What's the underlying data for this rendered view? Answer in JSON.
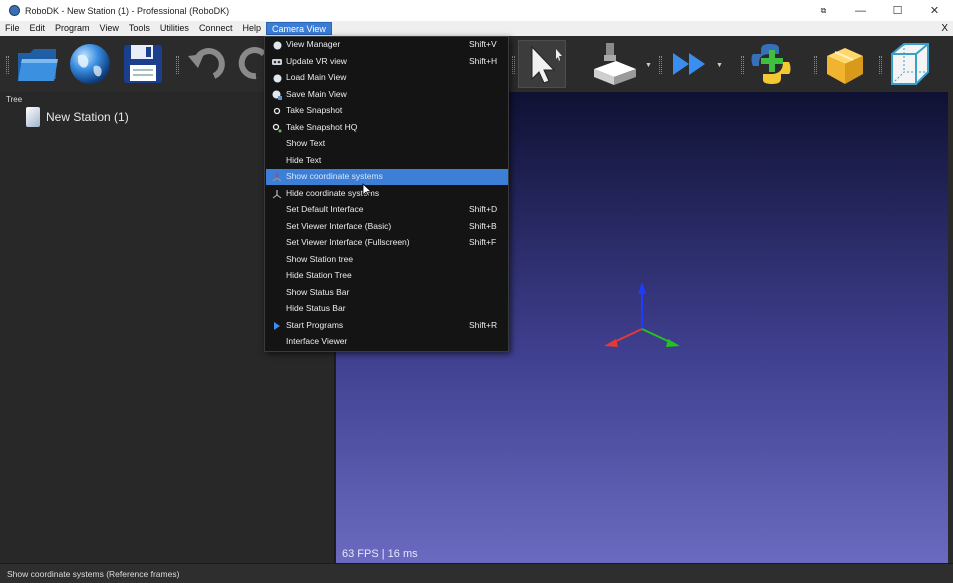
{
  "window": {
    "title": "RoboDK - New Station (1) - Professional (RoboDK)",
    "buttons": {
      "extra": "⧉",
      "minimize": "—",
      "maximize": "☐",
      "close": "✕"
    }
  },
  "menubar": {
    "items": [
      "File",
      "Edit",
      "Program",
      "View",
      "Tools",
      "Utilities",
      "Connect",
      "Help",
      "Camera View"
    ],
    "active": "Camera View",
    "close": "X"
  },
  "toolbar": {
    "tools": [
      {
        "name": "open-folder-icon"
      },
      {
        "name": "globe-icon"
      },
      {
        "name": "save-icon"
      },
      {
        "name": "undo-icon"
      },
      {
        "name": "redo-icon"
      },
      {
        "name": "select-cursor-icon",
        "pressed": true
      },
      {
        "name": "reference-frame-tool-icon"
      },
      {
        "name": "fast-forward-icon"
      },
      {
        "name": "python-add-icon"
      },
      {
        "name": "package-icon"
      },
      {
        "name": "view-cube-icon"
      }
    ]
  },
  "tree": {
    "label": "Tree",
    "nodes": [
      {
        "label": "New Station (1)",
        "icon": "station-icon"
      }
    ]
  },
  "viewport": {
    "fps_text": "63 FPS | 16 ms",
    "axes_colors": {
      "x": "#e53935",
      "y": "#21c321",
      "z": "#1c3cff"
    }
  },
  "menu": {
    "items": [
      {
        "label": "View Manager",
        "shortcut": "Shift+V",
        "icon": "globe-small-icon"
      },
      {
        "label": "Update VR view",
        "shortcut": "Shift+H",
        "icon": "vr-headset-icon"
      },
      {
        "label": "Load Main View",
        "shortcut": "",
        "icon": "globe-small-icon"
      },
      {
        "label": "Save Main View",
        "shortcut": "",
        "icon": "globe-save-icon"
      },
      {
        "label": "Take Snapshot",
        "shortcut": "",
        "icon": "dot-icon"
      },
      {
        "label": "Take Snapshot HQ",
        "shortcut": "",
        "icon": "snapshot-hq-icon"
      },
      {
        "label": "Show Text",
        "shortcut": "",
        "icon": ""
      },
      {
        "label": "Hide Text",
        "shortcut": "",
        "icon": ""
      },
      {
        "label": "Show coordinate systems",
        "shortcut": "",
        "icon": "coordinate-frame-icon",
        "highlight": true
      },
      {
        "label": "Hide coordinate systems",
        "shortcut": "",
        "icon": "coordinate-frame-off-icon"
      },
      {
        "label": "Set Default Interface",
        "shortcut": "Shift+D",
        "icon": ""
      },
      {
        "label": "Set Viewer Interface (Basic)",
        "shortcut": "Shift+B",
        "icon": ""
      },
      {
        "label": "Set Viewer Interface (Fullscreen)",
        "shortcut": "Shift+F",
        "icon": ""
      },
      {
        "label": "Show Station tree",
        "shortcut": "",
        "icon": ""
      },
      {
        "label": "Hide Station Tree",
        "shortcut": "",
        "icon": ""
      },
      {
        "label": "Show Status Bar",
        "shortcut": "",
        "icon": ""
      },
      {
        "label": "Hide Status Bar",
        "shortcut": "",
        "icon": ""
      },
      {
        "label": "Start Programs",
        "shortcut": "Shift+R",
        "icon": "play-icon"
      },
      {
        "label": "Interface Viewer",
        "shortcut": "",
        "icon": ""
      }
    ]
  },
  "statusbar": {
    "text": "Show coordinate systems (Reference frames)"
  },
  "colors": {
    "accent": "#3d7fd6",
    "menu_bg": "#141414",
    "panel_bg": "#282828"
  }
}
